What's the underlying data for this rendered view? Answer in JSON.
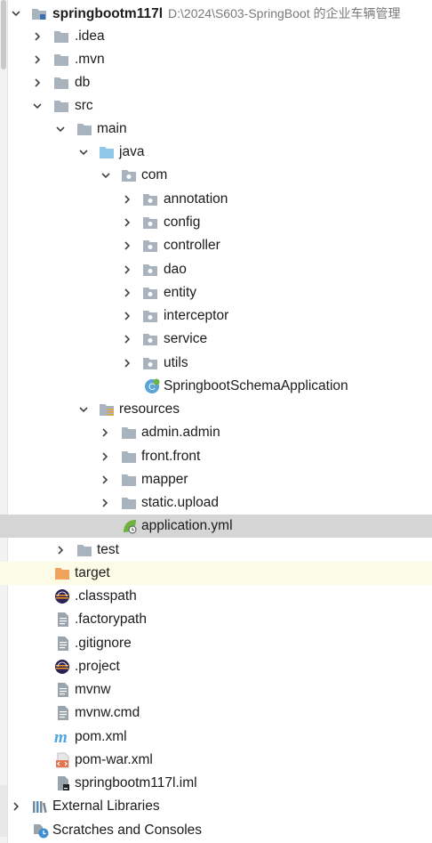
{
  "colors": {
    "folder": "#a9b3bd",
    "source_folder": "#8fc7e8",
    "excluded_folder": "#f0a35b",
    "selection": "#d5d5d5",
    "excluded_row": "#fcfbe6",
    "maven": "#50a5e0",
    "spring": "#6db33f"
  },
  "project": {
    "name": "springbootm117l",
    "path": "D:\\2024\\S603-SpringBoot 的企业车辆管理"
  },
  "tree": {
    "idea": "​.idea",
    "mvn": ".mvn",
    "db": "db",
    "src": "src",
    "main": "main",
    "java": "java",
    "com": "com",
    "annotation": "annotation",
    "config": "config",
    "controller": "controller",
    "dao": "dao",
    "entity": "entity",
    "interceptor": "interceptor",
    "service": "service",
    "utils": "utils",
    "app_class": "SpringbootSchemaApplication",
    "resources": "resources",
    "admin": "admin.admin",
    "front": "front.front",
    "mapper": "mapper",
    "static": "static.upload",
    "application_yml": "application.yml",
    "test": "test",
    "target": "target",
    "classpath": ".classpath",
    "factorypath": ".factorypath",
    "gitignore": ".gitignore",
    "project_file": ".project",
    "mvnw": "mvnw",
    "mvnw_cmd": "mvnw.cmd",
    "pom": "pom.xml",
    "pom_war": "pom-war.xml",
    "iml": "springbootm117l.iml",
    "external_libraries": "External Libraries",
    "scratches": "Scratches and Consoles"
  }
}
